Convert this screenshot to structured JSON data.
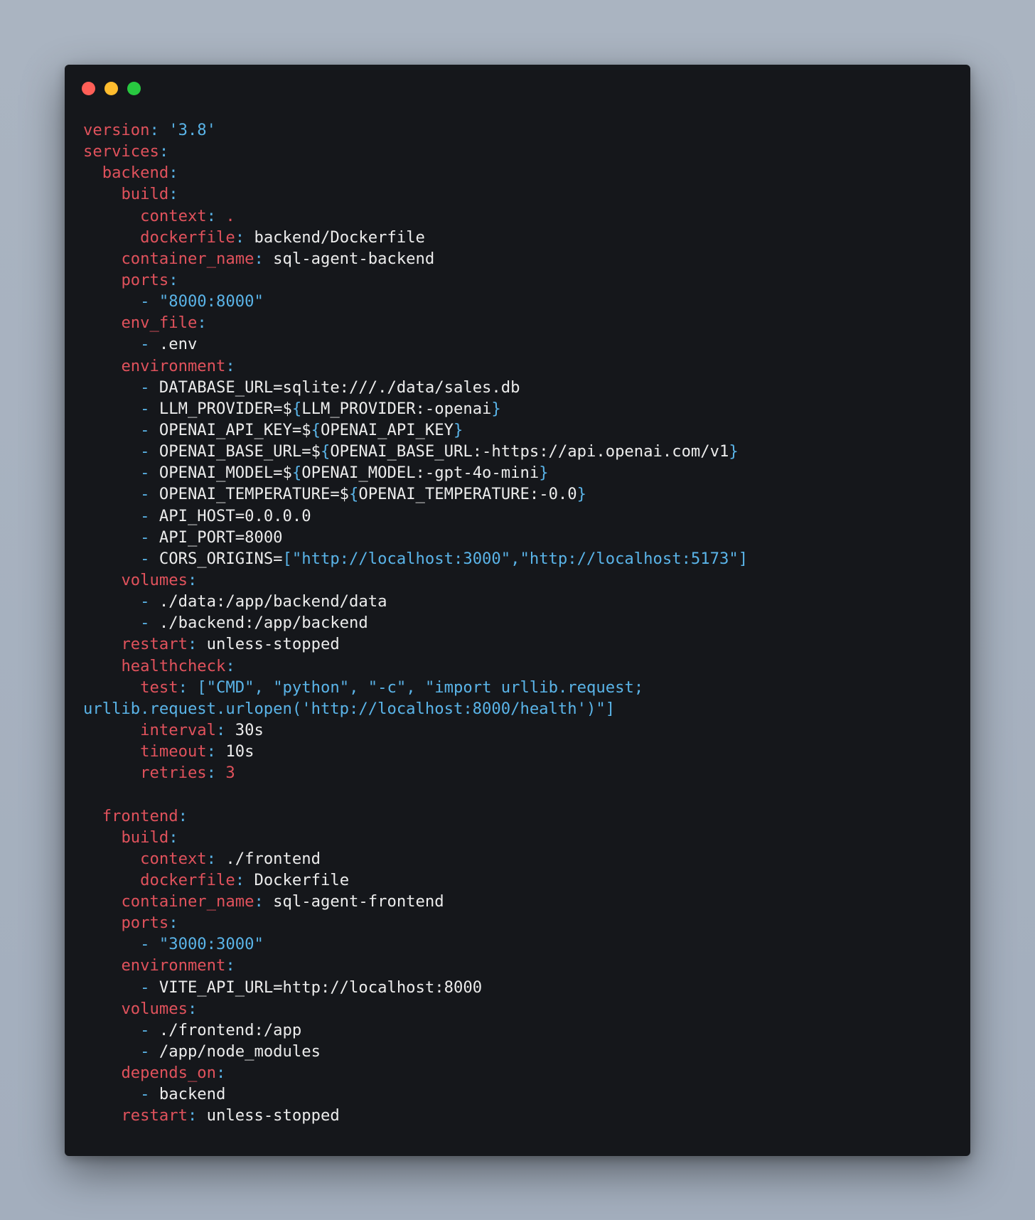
{
  "window": {
    "controls": [
      {
        "name": "close",
        "color": "#ff5f57"
      },
      {
        "name": "minimize",
        "color": "#febc2e"
      },
      {
        "name": "maximize",
        "color": "#28c840"
      }
    ]
  },
  "colors": {
    "key": "#e0525c",
    "punctuation": "#5ab4e8",
    "string": "#5ab4e8",
    "value": "#ececec",
    "background": "#15171b"
  },
  "lines": [
    [
      {
        "t": "k",
        "v": "version"
      },
      {
        "t": "p",
        "v": ": "
      },
      {
        "t": "s",
        "v": "'3.8'"
      }
    ],
    [
      {
        "t": "k",
        "v": "services"
      },
      {
        "t": "p",
        "v": ":"
      }
    ],
    [
      {
        "t": "v",
        "v": "  "
      },
      {
        "t": "k",
        "v": "backend"
      },
      {
        "t": "p",
        "v": ":"
      }
    ],
    [
      {
        "t": "v",
        "v": "    "
      },
      {
        "t": "k",
        "v": "build"
      },
      {
        "t": "p",
        "v": ":"
      }
    ],
    [
      {
        "t": "v",
        "v": "      "
      },
      {
        "t": "k",
        "v": "context"
      },
      {
        "t": "p",
        "v": ": "
      },
      {
        "t": "k",
        "v": "."
      }
    ],
    [
      {
        "t": "v",
        "v": "      "
      },
      {
        "t": "k",
        "v": "dockerfile"
      },
      {
        "t": "p",
        "v": ": "
      },
      {
        "t": "v",
        "v": "backend/Dockerfile"
      }
    ],
    [
      {
        "t": "v",
        "v": "    "
      },
      {
        "t": "k",
        "v": "container_name"
      },
      {
        "t": "p",
        "v": ": "
      },
      {
        "t": "v",
        "v": "sql-agent-backend"
      }
    ],
    [
      {
        "t": "v",
        "v": "    "
      },
      {
        "t": "k",
        "v": "ports"
      },
      {
        "t": "p",
        "v": ":"
      }
    ],
    [
      {
        "t": "v",
        "v": "      "
      },
      {
        "t": "p",
        "v": "- "
      },
      {
        "t": "s",
        "v": "\"8000:8000\""
      }
    ],
    [
      {
        "t": "v",
        "v": "    "
      },
      {
        "t": "k",
        "v": "env_file"
      },
      {
        "t": "p",
        "v": ":"
      }
    ],
    [
      {
        "t": "v",
        "v": "      "
      },
      {
        "t": "p",
        "v": "- "
      },
      {
        "t": "v",
        "v": ".env"
      }
    ],
    [
      {
        "t": "v",
        "v": "    "
      },
      {
        "t": "k",
        "v": "environment"
      },
      {
        "t": "p",
        "v": ":"
      }
    ],
    [
      {
        "t": "v",
        "v": "      "
      },
      {
        "t": "p",
        "v": "- "
      },
      {
        "t": "v",
        "v": "DATABASE_URL=sqlite:///./data/sales.db"
      }
    ],
    [
      {
        "t": "v",
        "v": "      "
      },
      {
        "t": "p",
        "v": "- "
      },
      {
        "t": "v",
        "v": "LLM_PROVIDER=$"
      },
      {
        "t": "p",
        "v": "{"
      },
      {
        "t": "v",
        "v": "LLM_PROVIDER:-openai"
      },
      {
        "t": "p",
        "v": "}"
      }
    ],
    [
      {
        "t": "v",
        "v": "      "
      },
      {
        "t": "p",
        "v": "- "
      },
      {
        "t": "v",
        "v": "OPENAI_API_KEY=$"
      },
      {
        "t": "p",
        "v": "{"
      },
      {
        "t": "v",
        "v": "OPENAI_API_KEY"
      },
      {
        "t": "p",
        "v": "}"
      }
    ],
    [
      {
        "t": "v",
        "v": "      "
      },
      {
        "t": "p",
        "v": "- "
      },
      {
        "t": "v",
        "v": "OPENAI_BASE_URL=$"
      },
      {
        "t": "p",
        "v": "{"
      },
      {
        "t": "v",
        "v": "OPENAI_BASE_URL:-https://api.openai.com/v1"
      },
      {
        "t": "p",
        "v": "}"
      }
    ],
    [
      {
        "t": "v",
        "v": "      "
      },
      {
        "t": "p",
        "v": "- "
      },
      {
        "t": "v",
        "v": "OPENAI_MODEL=$"
      },
      {
        "t": "p",
        "v": "{"
      },
      {
        "t": "v",
        "v": "OPENAI_MODEL:-gpt-4o-mini"
      },
      {
        "t": "p",
        "v": "}"
      }
    ],
    [
      {
        "t": "v",
        "v": "      "
      },
      {
        "t": "p",
        "v": "- "
      },
      {
        "t": "v",
        "v": "OPENAI_TEMPERATURE=$"
      },
      {
        "t": "p",
        "v": "{"
      },
      {
        "t": "v",
        "v": "OPENAI_TEMPERATURE:-0.0"
      },
      {
        "t": "p",
        "v": "}"
      }
    ],
    [
      {
        "t": "v",
        "v": "      "
      },
      {
        "t": "p",
        "v": "- "
      },
      {
        "t": "v",
        "v": "API_HOST=0.0.0.0"
      }
    ],
    [
      {
        "t": "v",
        "v": "      "
      },
      {
        "t": "p",
        "v": "- "
      },
      {
        "t": "v",
        "v": "API_PORT=8000"
      }
    ],
    [
      {
        "t": "v",
        "v": "      "
      },
      {
        "t": "p",
        "v": "- "
      },
      {
        "t": "v",
        "v": "CORS_ORIGINS="
      },
      {
        "t": "p",
        "v": "["
      },
      {
        "t": "s",
        "v": "\"http://localhost:3000\""
      },
      {
        "t": "p",
        "v": ","
      },
      {
        "t": "s",
        "v": "\"http://localhost:5173\""
      },
      {
        "t": "p",
        "v": "]"
      }
    ],
    [
      {
        "t": "v",
        "v": "    "
      },
      {
        "t": "k",
        "v": "volumes"
      },
      {
        "t": "p",
        "v": ":"
      }
    ],
    [
      {
        "t": "v",
        "v": "      "
      },
      {
        "t": "p",
        "v": "- "
      },
      {
        "t": "v",
        "v": "./data:/app/backend/data"
      }
    ],
    [
      {
        "t": "v",
        "v": "      "
      },
      {
        "t": "p",
        "v": "- "
      },
      {
        "t": "v",
        "v": "./backend:/app/backend"
      }
    ],
    [
      {
        "t": "v",
        "v": "    "
      },
      {
        "t": "k",
        "v": "restart"
      },
      {
        "t": "p",
        "v": ": "
      },
      {
        "t": "v",
        "v": "unless-stopped"
      }
    ],
    [
      {
        "t": "v",
        "v": "    "
      },
      {
        "t": "k",
        "v": "healthcheck"
      },
      {
        "t": "p",
        "v": ":"
      }
    ],
    [
      {
        "t": "v",
        "v": "      "
      },
      {
        "t": "k",
        "v": "test"
      },
      {
        "t": "p",
        "v": ": ["
      },
      {
        "t": "s",
        "v": "\"CMD\""
      },
      {
        "t": "p",
        "v": ", "
      },
      {
        "t": "s",
        "v": "\"python\""
      },
      {
        "t": "p",
        "v": ", "
      },
      {
        "t": "s",
        "v": "\"-c\""
      },
      {
        "t": "p",
        "v": ", "
      },
      {
        "t": "s",
        "v": "\"import urllib.request;"
      }
    ],
    [
      {
        "t": "s",
        "v": "urllib.request.urlopen('http://localhost:8000/health')\""
      },
      {
        "t": "p",
        "v": "]"
      }
    ],
    [
      {
        "t": "v",
        "v": "      "
      },
      {
        "t": "k",
        "v": "interval"
      },
      {
        "t": "p",
        "v": ": "
      },
      {
        "t": "v",
        "v": "30s"
      }
    ],
    [
      {
        "t": "v",
        "v": "      "
      },
      {
        "t": "k",
        "v": "timeout"
      },
      {
        "t": "p",
        "v": ": "
      },
      {
        "t": "v",
        "v": "10s"
      }
    ],
    [
      {
        "t": "v",
        "v": "      "
      },
      {
        "t": "k",
        "v": "retries"
      },
      {
        "t": "p",
        "v": ": "
      },
      {
        "t": "n",
        "v": "3"
      }
    ],
    [
      {
        "t": "v",
        "v": ""
      }
    ],
    [
      {
        "t": "v",
        "v": "  "
      },
      {
        "t": "k",
        "v": "frontend"
      },
      {
        "t": "p",
        "v": ":"
      }
    ],
    [
      {
        "t": "v",
        "v": "    "
      },
      {
        "t": "k",
        "v": "build"
      },
      {
        "t": "p",
        "v": ":"
      }
    ],
    [
      {
        "t": "v",
        "v": "      "
      },
      {
        "t": "k",
        "v": "context"
      },
      {
        "t": "p",
        "v": ": "
      },
      {
        "t": "v",
        "v": "./frontend"
      }
    ],
    [
      {
        "t": "v",
        "v": "      "
      },
      {
        "t": "k",
        "v": "dockerfile"
      },
      {
        "t": "p",
        "v": ": "
      },
      {
        "t": "v",
        "v": "Dockerfile"
      }
    ],
    [
      {
        "t": "v",
        "v": "    "
      },
      {
        "t": "k",
        "v": "container_name"
      },
      {
        "t": "p",
        "v": ": "
      },
      {
        "t": "v",
        "v": "sql-agent-frontend"
      }
    ],
    [
      {
        "t": "v",
        "v": "    "
      },
      {
        "t": "k",
        "v": "ports"
      },
      {
        "t": "p",
        "v": ":"
      }
    ],
    [
      {
        "t": "v",
        "v": "      "
      },
      {
        "t": "p",
        "v": "- "
      },
      {
        "t": "s",
        "v": "\"3000:3000\""
      }
    ],
    [
      {
        "t": "v",
        "v": "    "
      },
      {
        "t": "k",
        "v": "environment"
      },
      {
        "t": "p",
        "v": ":"
      }
    ],
    [
      {
        "t": "v",
        "v": "      "
      },
      {
        "t": "p",
        "v": "- "
      },
      {
        "t": "v",
        "v": "VITE_API_URL=http://localhost:8000"
      }
    ],
    [
      {
        "t": "v",
        "v": "    "
      },
      {
        "t": "k",
        "v": "volumes"
      },
      {
        "t": "p",
        "v": ":"
      }
    ],
    [
      {
        "t": "v",
        "v": "      "
      },
      {
        "t": "p",
        "v": "- "
      },
      {
        "t": "v",
        "v": "./frontend:/app"
      }
    ],
    [
      {
        "t": "v",
        "v": "      "
      },
      {
        "t": "p",
        "v": "- "
      },
      {
        "t": "v",
        "v": "/app/node_modules"
      }
    ],
    [
      {
        "t": "v",
        "v": "    "
      },
      {
        "t": "k",
        "v": "depends_on"
      },
      {
        "t": "p",
        "v": ":"
      }
    ],
    [
      {
        "t": "v",
        "v": "      "
      },
      {
        "t": "p",
        "v": "- "
      },
      {
        "t": "v",
        "v": "backend"
      }
    ],
    [
      {
        "t": "v",
        "v": "    "
      },
      {
        "t": "k",
        "v": "restart"
      },
      {
        "t": "p",
        "v": ": "
      },
      {
        "t": "v",
        "v": "unless-stopped"
      }
    ]
  ]
}
